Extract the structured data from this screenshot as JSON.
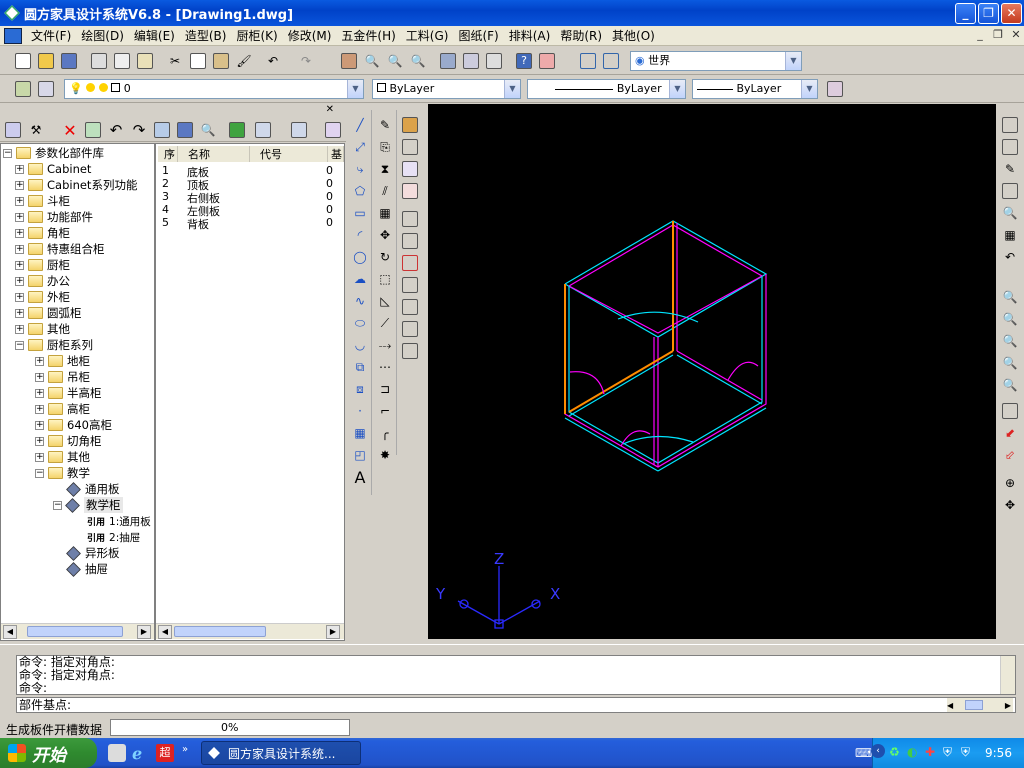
{
  "window": {
    "title": "圆方家具设计系统V6.8 - [Drawing1.dwg]"
  },
  "menu": [
    "文件(F)",
    "绘图(D)",
    "编辑(E)",
    "造型(B)",
    "厨柜(K)",
    "修改(M)",
    "五金件(H)",
    "工料(G)",
    "图纸(F)",
    "排料(A)",
    "帮助(R)",
    "其他(O)"
  ],
  "toolbar": {
    "ucs_combo": "世界",
    "layer_combo": "0",
    "color_combo": "ByLayer",
    "linetype_combo": "ByLayer",
    "lineweight_combo": "ByLayer"
  },
  "tree": {
    "root": "参数化部件库",
    "items": [
      "Cabinet",
      "Cabinet系列功能",
      "斗柜",
      "功能部件",
      "角柜",
      "特惠组合柜",
      "厨柜",
      "办公",
      "外柜",
      "圆弧柜",
      "其他",
      "厨柜系列"
    ],
    "sub": [
      "地柜",
      "吊柜",
      "半高柜",
      "高柜",
      "640高柜",
      "切角柜",
      "其他",
      "教学"
    ],
    "teaching": [
      "通用板",
      "教学柜"
    ],
    "refs": [
      "1:通用板",
      "2:抽屉"
    ],
    "tail": [
      "异形板",
      "抽屉"
    ],
    "ref_label": "引用"
  },
  "table": {
    "headers": [
      "序",
      "名称",
      "代号",
      "基"
    ],
    "rows": [
      {
        "no": "1",
        "name": "底板",
        "val": "0"
      },
      {
        "no": "2",
        "name": "顶板",
        "val": "0"
      },
      {
        "no": "3",
        "name": "右侧板",
        "val": "0"
      },
      {
        "no": "4",
        "name": "左侧板",
        "val": "0"
      },
      {
        "no": "5",
        "name": "背板",
        "val": "0"
      }
    ]
  },
  "ucs": {
    "x": "X",
    "y": "Y",
    "z": "Z"
  },
  "command": {
    "history": [
      "命令: 指定对角点:",
      "命令: 指定对角点:",
      "命令:"
    ],
    "prompt": "部件基点:"
  },
  "status": {
    "text": "生成板件开槽数据",
    "progress_text": "0%",
    "progress": 0
  },
  "taskbar": {
    "start": "开始",
    "task": "圆方家具设计系统...",
    "clock": "9:56"
  },
  "colors": {
    "cyan": "#00e5ff",
    "magenta": "#ff00ff",
    "orange": "#ff8c00"
  }
}
